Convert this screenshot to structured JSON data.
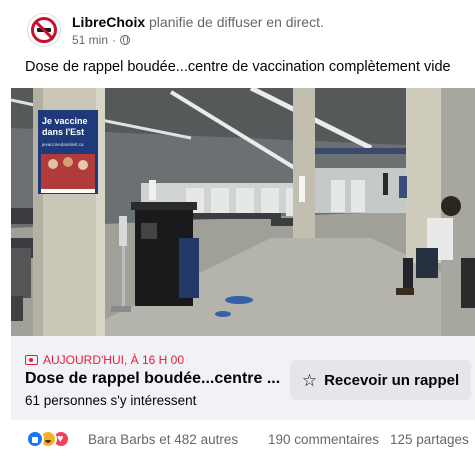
{
  "post": {
    "author": "LibreChoix",
    "action": "planifie de diffuser en direct.",
    "time": "51 min",
    "separator": "·",
    "text": "Dose de rappel boudée...centre de vaccination complètement vide"
  },
  "photo": {
    "poster_line1": "Je vaccine",
    "poster_line2": "dans l'Est",
    "poster_small": "jevaccinedanslest.ca"
  },
  "event": {
    "status": "AUJOURD'HUI, À 16 H 00",
    "title": "Dose de rappel boudée...centre ...",
    "interested": "61 personnes s'y intéressent",
    "remind_label": "Recevoir un rappel",
    "remind_icon": "star-icon"
  },
  "footer": {
    "reactions": [
      "like",
      "haha",
      "love"
    ],
    "reactors": "Bara Barbs et 482 autres",
    "comments": "190 commentaires",
    "shares": "125 partages"
  }
}
